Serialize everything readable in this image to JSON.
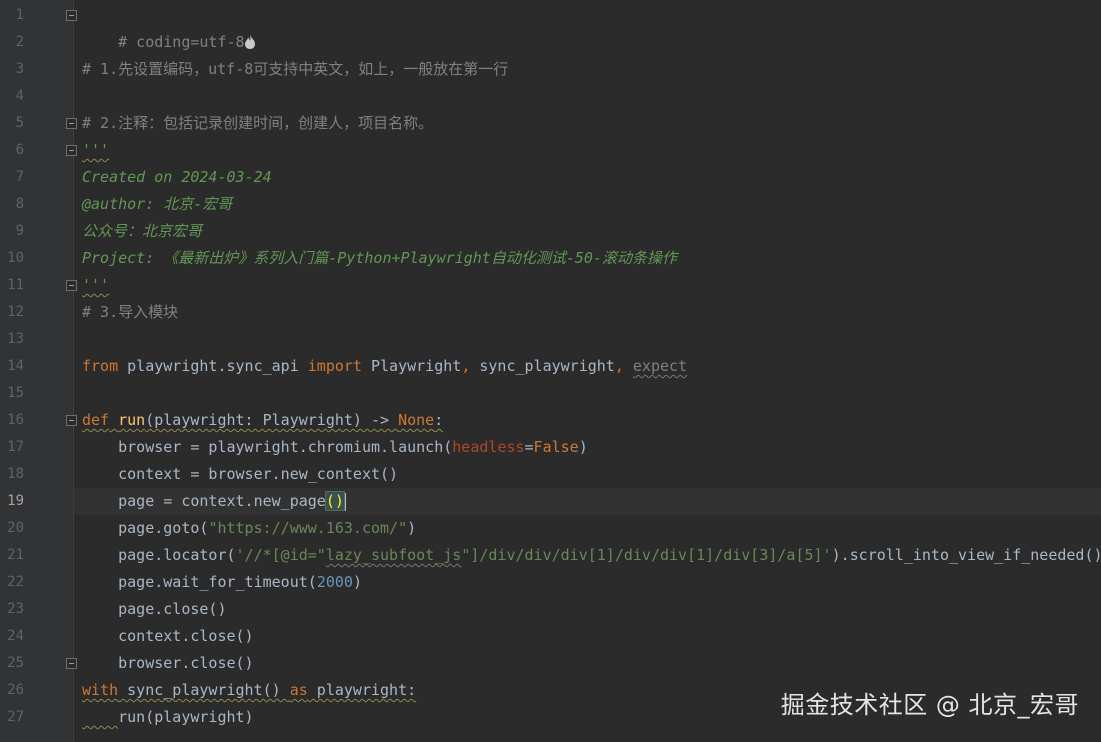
{
  "editor": {
    "lines": [
      {
        "num": "1",
        "text": "# coding=utf-8"
      },
      {
        "num": "2",
        "text": ""
      },
      {
        "num": "3",
        "text": "# 1.先设置编码，utf-8可支持中英文，如上，一般放在第一行"
      },
      {
        "num": "4",
        "text": ""
      },
      {
        "num": "5",
        "text": "# 2.注释：包括记录创建时间，创建人，项目名称。"
      },
      {
        "num": "6",
        "text": "'''"
      },
      {
        "num": "7",
        "text": "Created on 2024-03-24"
      },
      {
        "num": "8",
        "text": "@author: 北京-宏哥"
      },
      {
        "num": "9",
        "text": "公众号：北京宏哥"
      },
      {
        "num": "10",
        "text": "Project: 《最新出炉》系列入门篇-Python+Playwright自动化测试-50-滚动条操作"
      },
      {
        "num": "11",
        "text": "'''"
      },
      {
        "num": "12",
        "text": "# 3.导入模块"
      },
      {
        "num": "13",
        "text": ""
      },
      {
        "num": "14",
        "text": "from playwright.sync_api import Playwright, sync_playwright, expect"
      },
      {
        "num": "15",
        "text": ""
      },
      {
        "num": "16",
        "text": "def run(playwright: Playwright) -> None:"
      },
      {
        "num": "17",
        "text": "    browser = playwright.chromium.launch(headless=False)"
      },
      {
        "num": "18",
        "text": "    context = browser.new_context()"
      },
      {
        "num": "19",
        "text": "    page = context.new_page()"
      },
      {
        "num": "20",
        "text": "    page.goto(\"https://www.163.com/\")"
      },
      {
        "num": "21",
        "text": "    page.locator('//*[@id=\"lazy_subfoot_js\"]/div/div/div[1]/div/div[1]/div[3]/a[5]').scroll_into_view_if_needed()"
      },
      {
        "num": "22",
        "text": "    page.wait_for_timeout(2000)"
      },
      {
        "num": "23",
        "text": "    page.close()"
      },
      {
        "num": "24",
        "text": "    context.close()"
      },
      {
        "num": "25",
        "text": "    browser.close()"
      },
      {
        "num": "26",
        "text": "with sync_playwright() as playwright:"
      },
      {
        "num": "27",
        "text": "    run(playwright)"
      }
    ],
    "current_line": "19",
    "tokens": {
      "l1": "# coding=utf-8",
      "l3": "# 1.先设置编码，utf-8可支持中英文，如上，一般放在第一行",
      "l5": "# 2.注释：包括记录创建时间，创建人，项目名称。",
      "l6": "'''",
      "l7": "Created on 2024-03-24",
      "l8": "@author: 北京-宏哥",
      "l9": "公众号：北京宏哥",
      "l10": "Project: 《最新出炉》系列入门篇-Python+Playwright自动化测试-50-滚动条操作",
      "l11": "'''",
      "l12": "# 3.导入模块",
      "l14_from": "from",
      "l14_mod": " playwright.sync_api ",
      "l14_import": "import",
      "l14_a": " Playwright",
      "l14_c1": ",",
      "l14_b": " sync_playwright",
      "l14_c2": ",",
      "l14_sp": " ",
      "l14_expect": "expect",
      "l16_def": "def",
      "l16_sp": " ",
      "l16_run": "run",
      "l16_sig": "(playwright: Playwright) -> ",
      "l16_none": "None",
      "l16_colon": ":",
      "l17_a": "    browser = playwright.chromium.launch(",
      "l17_param": "headless",
      "l17_eq": "=",
      "l17_false": "False",
      "l17_close": ")",
      "l18": "    context = browser.new_context()",
      "l19_a": "    page = context.new_page",
      "l19_paren": "()",
      "l20_a": "    page.goto(",
      "l20_str": "\"https://www.163.com/\"",
      "l20_close": ")",
      "l21_a": "    page.locator(",
      "l21_str1": "'//*[@id=\"",
      "l21_str2": "lazy_subfoot_js",
      "l21_str3": "\"]/div/div/div[1]/div/div[1]/div[3]/a[5]'",
      "l21_close": ").scroll_into_view_if_needed()",
      "l22_a": "    page.wait_for_timeout(",
      "l22_num": "2000",
      "l22_close": ")",
      "l23": "    page.close()",
      "l24": "    context.close()",
      "l25": "    browser.close()",
      "l26_with": "with",
      "l26_mid": " sync_playwright() ",
      "l26_as": "as",
      "l26_end": " playwright:",
      "l27_indent": "    ",
      "l27_rest": "run(playwright)"
    }
  },
  "watermark": "掘金技术社区 @ 北京_宏哥",
  "colors": {
    "background": "#2b2b2b",
    "gutter": "#313335",
    "comment": "#808080",
    "docstring": "#629755",
    "keyword": "#cc7832",
    "string": "#6a8759",
    "number": "#6897bb",
    "param": "#aa4926"
  },
  "icons": {
    "fold_markers": [
      "fold-open-icon",
      "fold-close-icon"
    ],
    "line1_marker": "flame-icon"
  }
}
